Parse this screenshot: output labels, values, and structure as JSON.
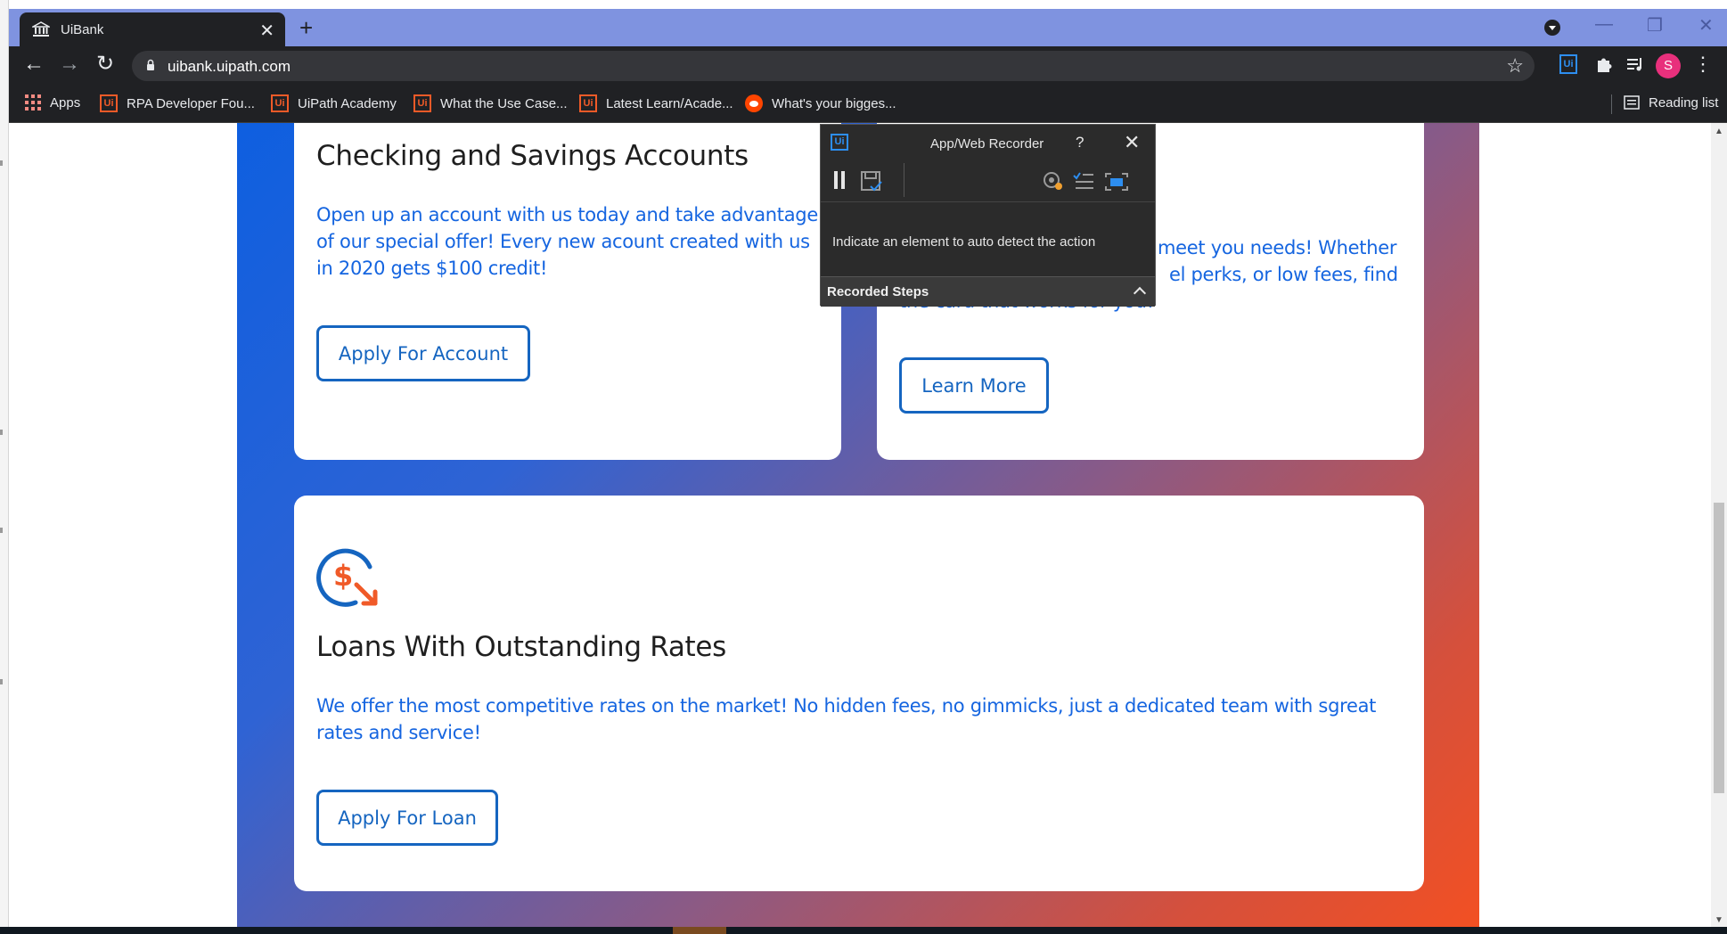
{
  "browser": {
    "tab": {
      "title": "UiBank",
      "close_glyph": "✕"
    },
    "new_tab_glyph": "+",
    "window_controls": {
      "minimize": "—",
      "restore": "❐",
      "close": "✕"
    },
    "nav": {
      "back": "←",
      "forward": "→",
      "reload": "↻"
    },
    "url": "uibank.uipath.com",
    "star_glyph": "☆",
    "profile_initial": "S",
    "bookmarks": [
      {
        "label": "Apps",
        "icon": "apps-grid-icon"
      },
      {
        "label": "RPA Developer Fou...",
        "icon": "uipath-icon"
      },
      {
        "label": "UiPath Academy",
        "icon": "uipath-icon"
      },
      {
        "label": "What the Use Case...",
        "icon": "uipath-icon"
      },
      {
        "label": "Latest Learn/Acade...",
        "icon": "uipath-icon"
      },
      {
        "label": "What's your bigges...",
        "icon": "reddit-icon"
      }
    ],
    "reading_list": "Reading list",
    "ui_icon_text": "Ui"
  },
  "cards": {
    "accounts": {
      "title": "Checking and Savings Accounts",
      "body": "Open up an account with us today and take advantage of our special offer! Every new acount created with us in 2020 gets $100 credit!",
      "button": "Apply For Account"
    },
    "credit": {
      "body_line1": "meet you needs! Whether",
      "body_line2": "el perks, or low fees, find",
      "body_line3": "the card that works for you!",
      "button": "Learn More"
    },
    "loans": {
      "title": "Loans With Outstanding Rates",
      "body": "We offer the most competitive rates on the market! No hidden fees, no gimmicks, just a dedicated team with sgreat rates and service!",
      "button": "Apply For Loan"
    }
  },
  "recorder": {
    "logo": "Ui",
    "title": "App/Web Recorder",
    "help": "?",
    "close": "✕",
    "hint": "Indicate an element to auto detect the action",
    "recorded_steps": "Recorded Steps"
  },
  "colors": {
    "tabbar": "#7f93e0",
    "chrome_dark": "#202124",
    "link_blue": "#1565c0",
    "accent_orange": "#f05a28"
  }
}
